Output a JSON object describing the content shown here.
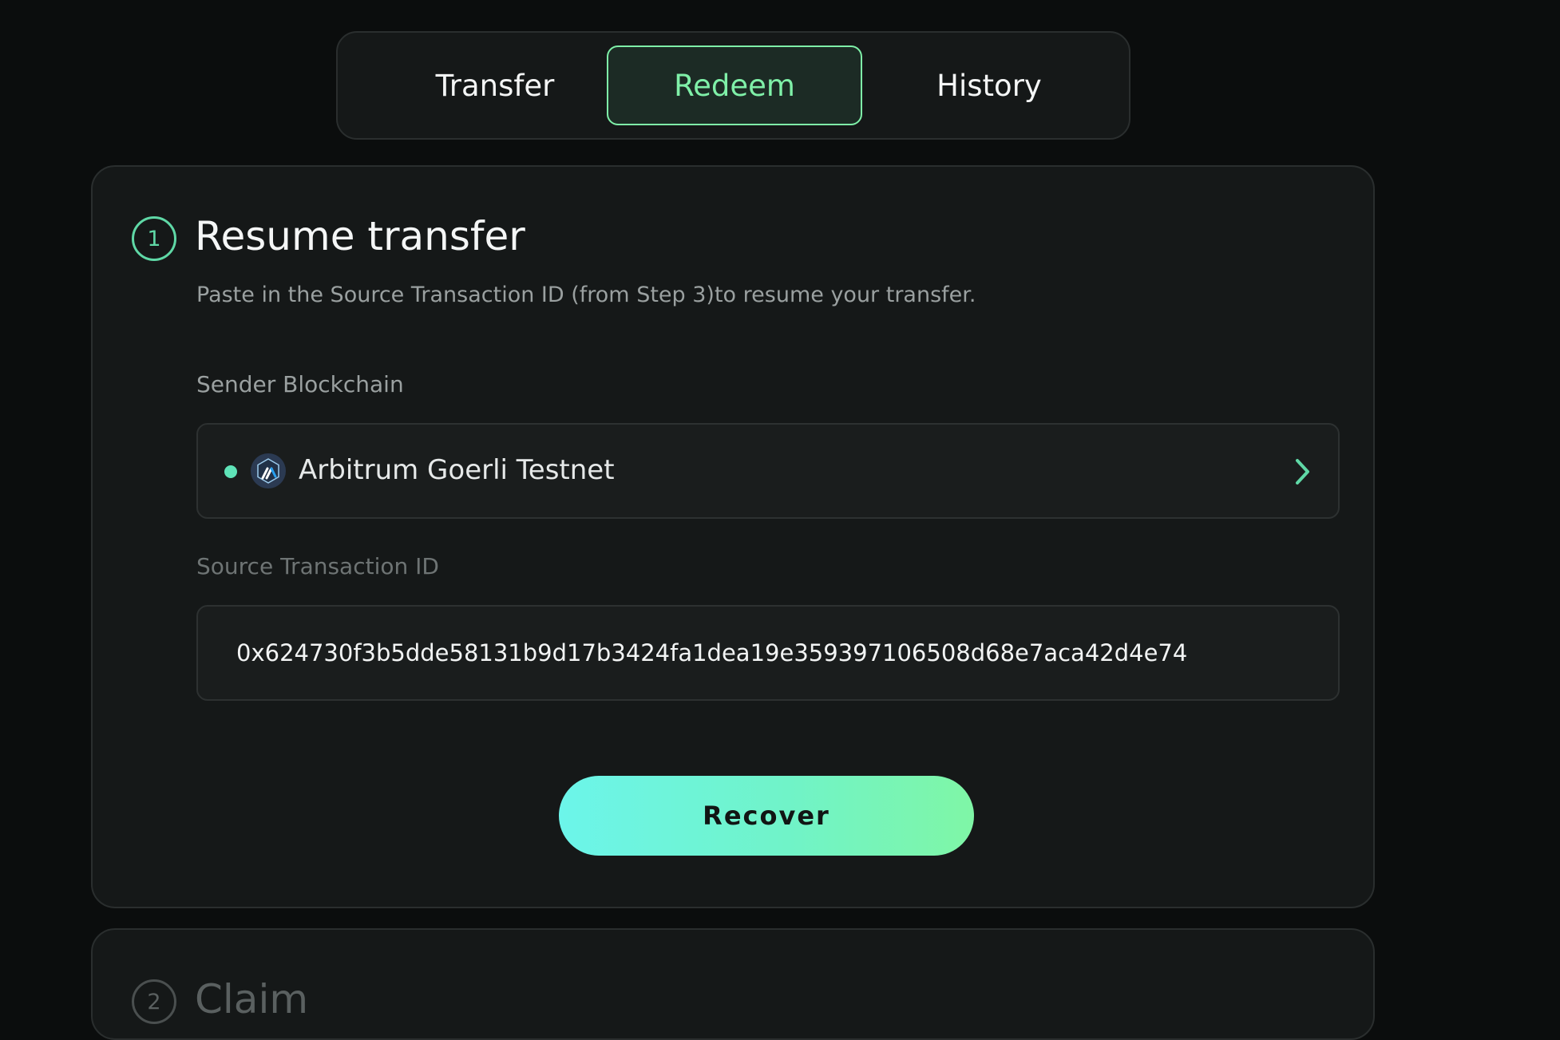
{
  "tabs": [
    {
      "label": "Transfer",
      "active": false
    },
    {
      "label": "Redeem",
      "active": true
    },
    {
      "label": "History",
      "active": false
    }
  ],
  "step1": {
    "number": "1",
    "title": "Resume transfer",
    "description": "Paste in the Source Transaction ID (from Step 3)to resume your transfer.",
    "sender_label": "Sender Blockchain",
    "sender_value": "Arbitrum Goerli Testnet",
    "sender_icon": "arbitrum-logo-icon",
    "source_label": "Source Transaction ID",
    "source_value": "0x624730f3b5dde58131b9d17b3424fa1dea19e359397106508d68e7aca42d4e74",
    "recover_label": "Recover"
  },
  "step2": {
    "number": "2",
    "title": "Claim"
  },
  "colors": {
    "accent": "#7ff0a8",
    "teal": "#5fd8a6",
    "background": "#0b0d0d",
    "card": "#151818"
  }
}
